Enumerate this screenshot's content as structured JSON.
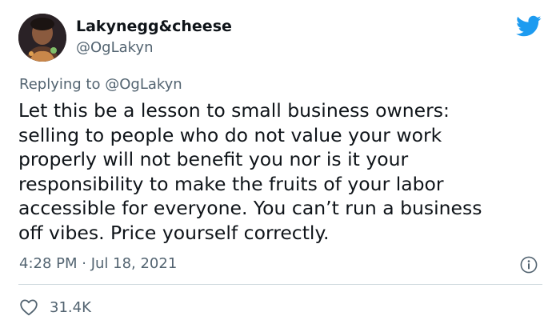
{
  "author": {
    "display_name": "Lakynegg&cheese",
    "handle": "@OgLakyn",
    "avatar_icon": "profile-avatar"
  },
  "reply_context": {
    "prefix": "Replying to",
    "mention": "@OgLakyn"
  },
  "tweet": {
    "lines": [
      "Let this be a lesson to small business owners:",
      "selling to people who do not value your work",
      "properly will not benefit you nor is it your",
      "responsibility to make the fruits of your labor",
      "accessible for everyone. You can’t run a business",
      "off vibes. Price yourself correctly."
    ],
    "timestamp": "4:28 PM · Jul 18, 2021"
  },
  "engagement": {
    "likes": "31.4K"
  },
  "icons": {
    "brand": "twitter-bird-icon",
    "info": "info-icon",
    "like": "heart-icon"
  },
  "colors": {
    "brand_blue": "#1d9bf0",
    "text_primary": "#0f1419",
    "text_secondary": "#536471",
    "divider": "#cfd9de"
  }
}
